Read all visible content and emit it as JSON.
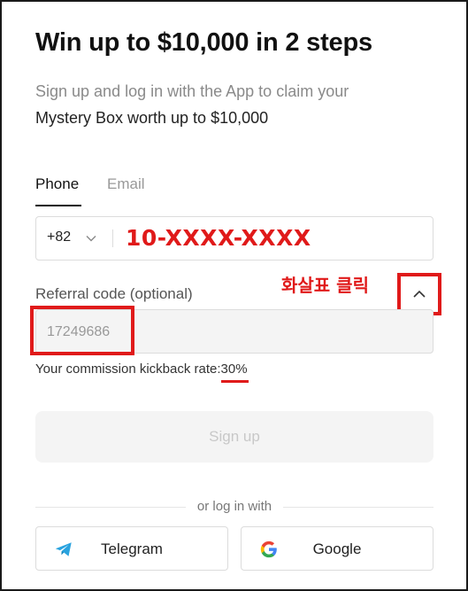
{
  "header": {
    "title": "Win up to $10,000 in 2 steps",
    "subtitle_line1": "Sign up and log in with the App to claim your",
    "subtitle_line2": "Mystery Box worth up to $10,000"
  },
  "tabs": [
    {
      "label": "Phone",
      "active": true
    },
    {
      "label": "Email",
      "active": false
    }
  ],
  "phone": {
    "country_code": "+82",
    "annotation": "10-XXXX-XXXX"
  },
  "referral": {
    "label": "Referral code (optional)",
    "value": "17249686",
    "annotation": "화살표 클릭"
  },
  "commission": {
    "text": "Your commission kickback rate:30%"
  },
  "signup": {
    "label": "Sign up"
  },
  "alt_login": {
    "divider_text": "or log in with",
    "telegram_label": "Telegram",
    "google_label": "Google"
  },
  "colors": {
    "annotation_red": "#e01a1a",
    "telegram_blue": "#2aa3df"
  },
  "icons": {
    "country_dropdown": "chevron-down-icon",
    "referral_toggle": "chevron-up-icon",
    "telegram": "telegram-icon",
    "google": "google-icon"
  }
}
